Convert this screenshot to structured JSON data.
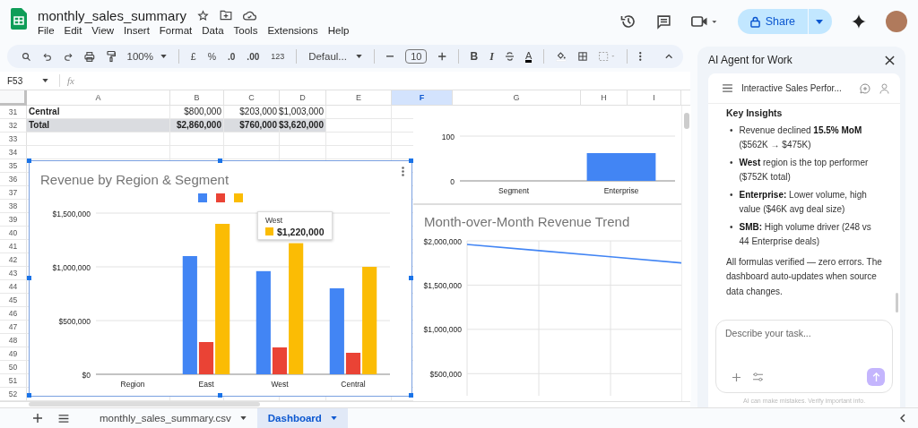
{
  "document": {
    "title": "monthly_sales_summary"
  },
  "menu": [
    "File",
    "Edit",
    "View",
    "Insert",
    "Format",
    "Data",
    "Tools",
    "Extensions",
    "Help"
  ],
  "share": {
    "label": "Share"
  },
  "toolbar": {
    "zoom": "100%",
    "currency": "£",
    "percent": "%",
    "decrease_decimals": ".0",
    "increase_decimals": ".00",
    "number_format": "123",
    "font": "Defaul...",
    "font_size": "10",
    "bold": "B",
    "italic": "I",
    "text_color": "A"
  },
  "formula_bar": {
    "cell_ref": "F53",
    "fx": "fx"
  },
  "grid": {
    "columns": [
      {
        "label": "A",
        "selected": false
      },
      {
        "label": "B",
        "selected": false
      },
      {
        "label": "C",
        "selected": false
      },
      {
        "label": "D",
        "selected": false
      },
      {
        "label": "E",
        "selected": false
      },
      {
        "label": "F",
        "selected": true
      },
      {
        "label": "G",
        "selected": false
      },
      {
        "label": "H",
        "selected": false
      },
      {
        "label": "I",
        "selected": false
      }
    ],
    "rows": [
      {
        "number": "31",
        "kind": "data",
        "cells": [
          "Central",
          "$800,000",
          "$203,000",
          "$1,003,000"
        ]
      },
      {
        "number": "32",
        "kind": "total",
        "cells": [
          "Total",
          "$2,860,000",
          "$760,000",
          "$3,620,000"
        ]
      },
      {
        "number": "33"
      },
      {
        "number": "34"
      },
      {
        "number": "35"
      },
      {
        "number": "36"
      },
      {
        "number": "37"
      },
      {
        "number": "38"
      },
      {
        "number": "39"
      },
      {
        "number": "40"
      },
      {
        "number": "41"
      },
      {
        "number": "42"
      },
      {
        "number": "43"
      },
      {
        "number": "44"
      },
      {
        "number": "45"
      },
      {
        "number": "46"
      },
      {
        "number": "47"
      },
      {
        "number": "48"
      },
      {
        "number": "49"
      },
      {
        "number": "50"
      },
      {
        "number": "51"
      },
      {
        "number": "52"
      }
    ]
  },
  "charts": [
    {
      "selected": true,
      "tooltip": {
        "label": "West",
        "value": "$1,220,000",
        "color": "#fbbc04"
      },
      "chart_data": {
        "type": "bar",
        "title": "Revenue by Region & Segment",
        "categories": [
          "Region",
          "East",
          "West",
          "Central"
        ],
        "series": [
          {
            "color": "#4285f4",
            "values": [
              null,
              1100000,
              960000,
              800000
            ]
          },
          {
            "color": "#ea4335",
            "values": [
              null,
              300000,
              250000,
              200000
            ]
          },
          {
            "color": "#fbbc04",
            "values": [
              null,
              1400000,
              1220000,
              1000000
            ]
          }
        ],
        "ylim": [
          0,
          1500000
        ],
        "yticks": [
          {
            "value": 0,
            "label": "$0"
          },
          {
            "value": 500000,
            "label": "$500,000"
          },
          {
            "value": 1000000,
            "label": "$1,000,000"
          },
          {
            "value": 1500000,
            "label": "$1,500,000"
          }
        ]
      }
    },
    {
      "selected": false,
      "chart_data": {
        "type": "bar",
        "categories": [
          "Segment",
          "Enterprise"
        ],
        "series": [
          {
            "color": "#4285f4",
            "values": [
              null,
              62
            ]
          }
        ],
        "ylim": [
          0,
          100
        ],
        "yticks": [
          0,
          100
        ]
      }
    },
    {
      "selected": false,
      "chart_data": {
        "type": "line",
        "grid": true,
        "title": "Month-over-Month Revenue Trend",
        "series": [
          {
            "color": "#4285f4",
            "values": [
              1960000,
              1890000,
              1820000,
              1750000
            ]
          }
        ],
        "ylim": [
          250000,
          2000000
        ],
        "yticks": [
          {
            "value": 500000,
            "label": "$500,000"
          },
          {
            "value": 1000000,
            "label": "$1,000,000"
          },
          {
            "value": 1500000,
            "label": "$1,500,000"
          },
          {
            "value": 2000000,
            "label": "$2,000,000"
          }
        ]
      }
    }
  ],
  "sheet_tabs": [
    {
      "label": "monthly_sales_summary.csv",
      "selected": false
    },
    {
      "label": "Dashboard",
      "selected": true
    }
  ],
  "agent_panel": {
    "title": "AI Agent for Work",
    "conversation_title": "Interactive Sales Perfor...",
    "heading": "Key Insights",
    "bullet": "•",
    "bullets": [
      "Revenue declined **15.5% MoM** ($562K → $475K)",
      "**West** region is the top performer ($752K total)",
      "**Enterprise:** Lower volume, high value ($46K avg deal size)",
      "**SMB:** High volume driver (248 vs 44 Enterprise deals)"
    ],
    "summary": "All formulas verified — zero errors. The dashboard auto-updates when source data changes.",
    "input": {
      "placeholder": "Describe your task..."
    },
    "send_enabled": false,
    "disclaimer": "AI can make mistakes. Verify important info."
  }
}
